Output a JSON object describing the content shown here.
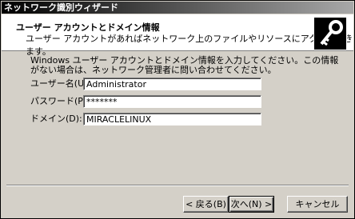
{
  "window": {
    "title": "ネットワーク識別ウィザード"
  },
  "header": {
    "title": "ユーザー アカウントとドメイン情報",
    "subtitle": "ユーザー アカウントがあればネットワーク上のファイルやリソースにアクセスできます。",
    "icon": "key-icon"
  },
  "intro": "Windows ユーザー アカウントとドメイン情報を入力してください。この情報がない場合は、ネットワーク管理者に問い合わせてください。",
  "fields": {
    "username": {
      "label": "ユーザー名(U):",
      "value": "Administrator"
    },
    "password": {
      "label": "パスワード(P):",
      "value": "*******"
    },
    "domain": {
      "label": "ドメイン(D):",
      "value": "MIRACLELINUX"
    }
  },
  "buttons": {
    "back": "< 戻る(B)",
    "next": "次へ(N) >",
    "cancel": "キャンセル"
  }
}
